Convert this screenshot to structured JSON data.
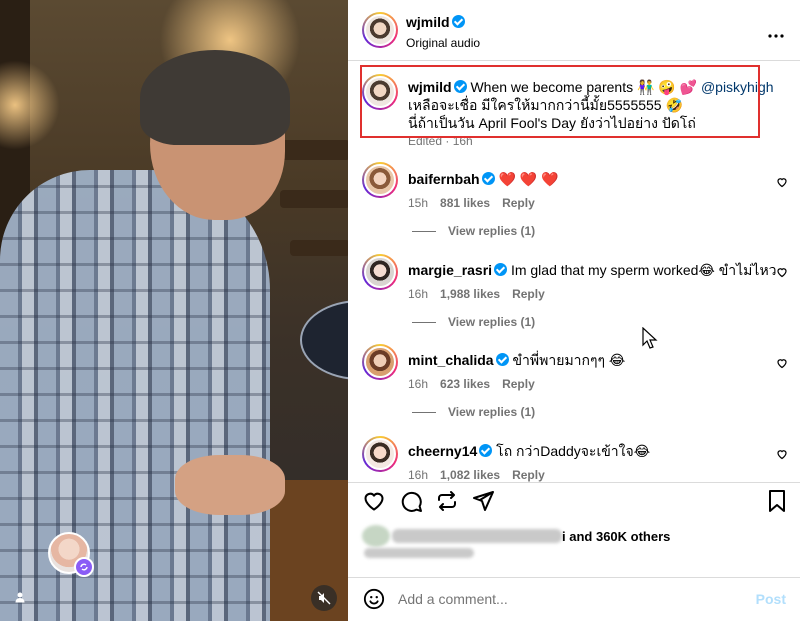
{
  "header": {
    "username": "wjmild",
    "audio_label": "Original audio",
    "more_icon": "more-horizontal-icon"
  },
  "caption": {
    "username": "wjmild",
    "line1_text": "When we become parents 👫 🤪 💕",
    "mention": "@piskyhigh",
    "line2": "เหลือจะเชื่อ มีใครให้มากกว่านี้มั้ย5555555 🤣",
    "line3": "นี่ถ้าเป็นวัน April Fool's Day ยังว่าไปอย่าง ปัดโถ่",
    "meta": "Edited · 16h"
  },
  "comments": [
    {
      "username": "baifernbah",
      "text": "❤️ ❤️ ❤️",
      "time": "15h",
      "likes": "881 likes",
      "reply": "Reply",
      "view_replies": "View replies (1)"
    },
    {
      "username": "margie_rasri",
      "text": "Im glad that my sperm worked😂 ขำไม่ไหว",
      "time": "16h",
      "likes": "1,988 likes",
      "reply": "Reply",
      "view_replies": "View replies (1)"
    },
    {
      "username": "mint_chalida",
      "text": "ขำพี่พายมากๆๆ 😂",
      "time": "16h",
      "likes": "623 likes",
      "reply": "Reply",
      "view_replies": "View replies (1)"
    },
    {
      "username": "cheerny14",
      "text": "โถ กว่าDaddyจะเข้าใจ😂",
      "time": "16h",
      "likes": "1,082 likes",
      "reply": "Reply"
    }
  ],
  "likes_summary": {
    "suffix": "i and",
    "count": "360K others"
  },
  "comment_box": {
    "placeholder": "Add a comment...",
    "post_label": "Post"
  },
  "colors": {
    "verified": "#0095f6",
    "mention": "#00376b",
    "highlight": "#e0302e",
    "post": "#b2dffc"
  }
}
